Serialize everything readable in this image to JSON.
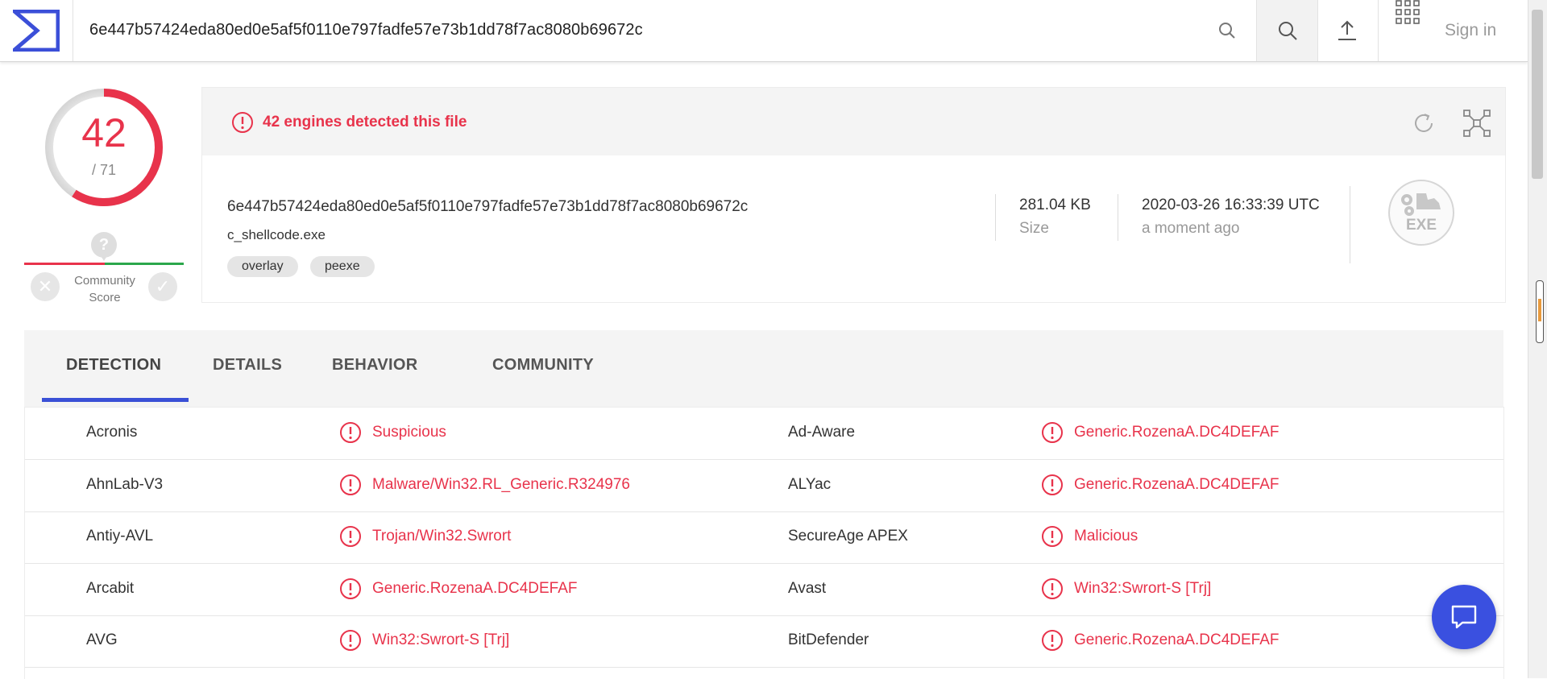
{
  "topbar": {
    "search_value": "6e447b57424eda80ed0e5af5f0110e797fadfe57e73b1dd78f7ac8080b69672c",
    "sign_in_label": "Sign in"
  },
  "score": {
    "detected": "42",
    "total": "/ 71",
    "detected_count": 42,
    "engines_total": 71,
    "community_label": "Community Score",
    "community_unknown_symbol": "?"
  },
  "summary": {
    "alert_text": "42 engines detected this file",
    "hash": "6e447b57424eda80ed0e5af5f0110e797fadfe57e73b1dd78f7ac8080b69672c",
    "file_name": "c_shellcode.exe",
    "tags": [
      "overlay",
      "peexe"
    ],
    "size_value": "281.04 KB",
    "size_label": "Size",
    "date_value": "2020-03-26 16:33:39 UTC",
    "date_label": "a moment ago",
    "file_type_badge": "EXE"
  },
  "tabs": [
    {
      "label": "DETECTION",
      "active": true
    },
    {
      "label": "DETAILS",
      "active": false
    },
    {
      "label": "BEHAVIOR",
      "active": false
    },
    {
      "label": "COMMUNITY",
      "active": false
    }
  ],
  "detections": [
    {
      "left_engine": "Acronis",
      "left_result": "Suspicious",
      "right_engine": "Ad-Aware",
      "right_result": "Generic.RozenaA.DC4DEFAF"
    },
    {
      "left_engine": "AhnLab-V3",
      "left_result": "Malware/Win32.RL_Generic.R324976",
      "right_engine": "ALYac",
      "right_result": "Generic.RozenaA.DC4DEFAF"
    },
    {
      "left_engine": "Antiy-AVL",
      "left_result": "Trojan/Win32.Swrort",
      "right_engine": "SecureAge APEX",
      "right_result": "Malicious"
    },
    {
      "left_engine": "Arcabit",
      "left_result": "Generic.RozenaA.DC4DEFAF",
      "right_engine": "Avast",
      "right_result": "Win32:Swrort-S [Trj]"
    },
    {
      "left_engine": "AVG",
      "left_result": "Win32:Swrort-S [Trj]",
      "right_engine": "BitDefender",
      "right_result": "Generic.RozenaA.DC4DEFAF"
    }
  ],
  "colors": {
    "malicious_red": "#e8334b",
    "accent_blue": "#3a50d6",
    "harmless_green": "#2ba74b"
  },
  "icons": {
    "logo": "virustotal-sigma-logo",
    "search": "search-icon",
    "upload": "upload-icon",
    "apps": "apps-grid-icon",
    "alert": "alert-circle-icon",
    "reload": "reload-icon",
    "graph": "graph-icon",
    "chat": "chat-icon"
  }
}
